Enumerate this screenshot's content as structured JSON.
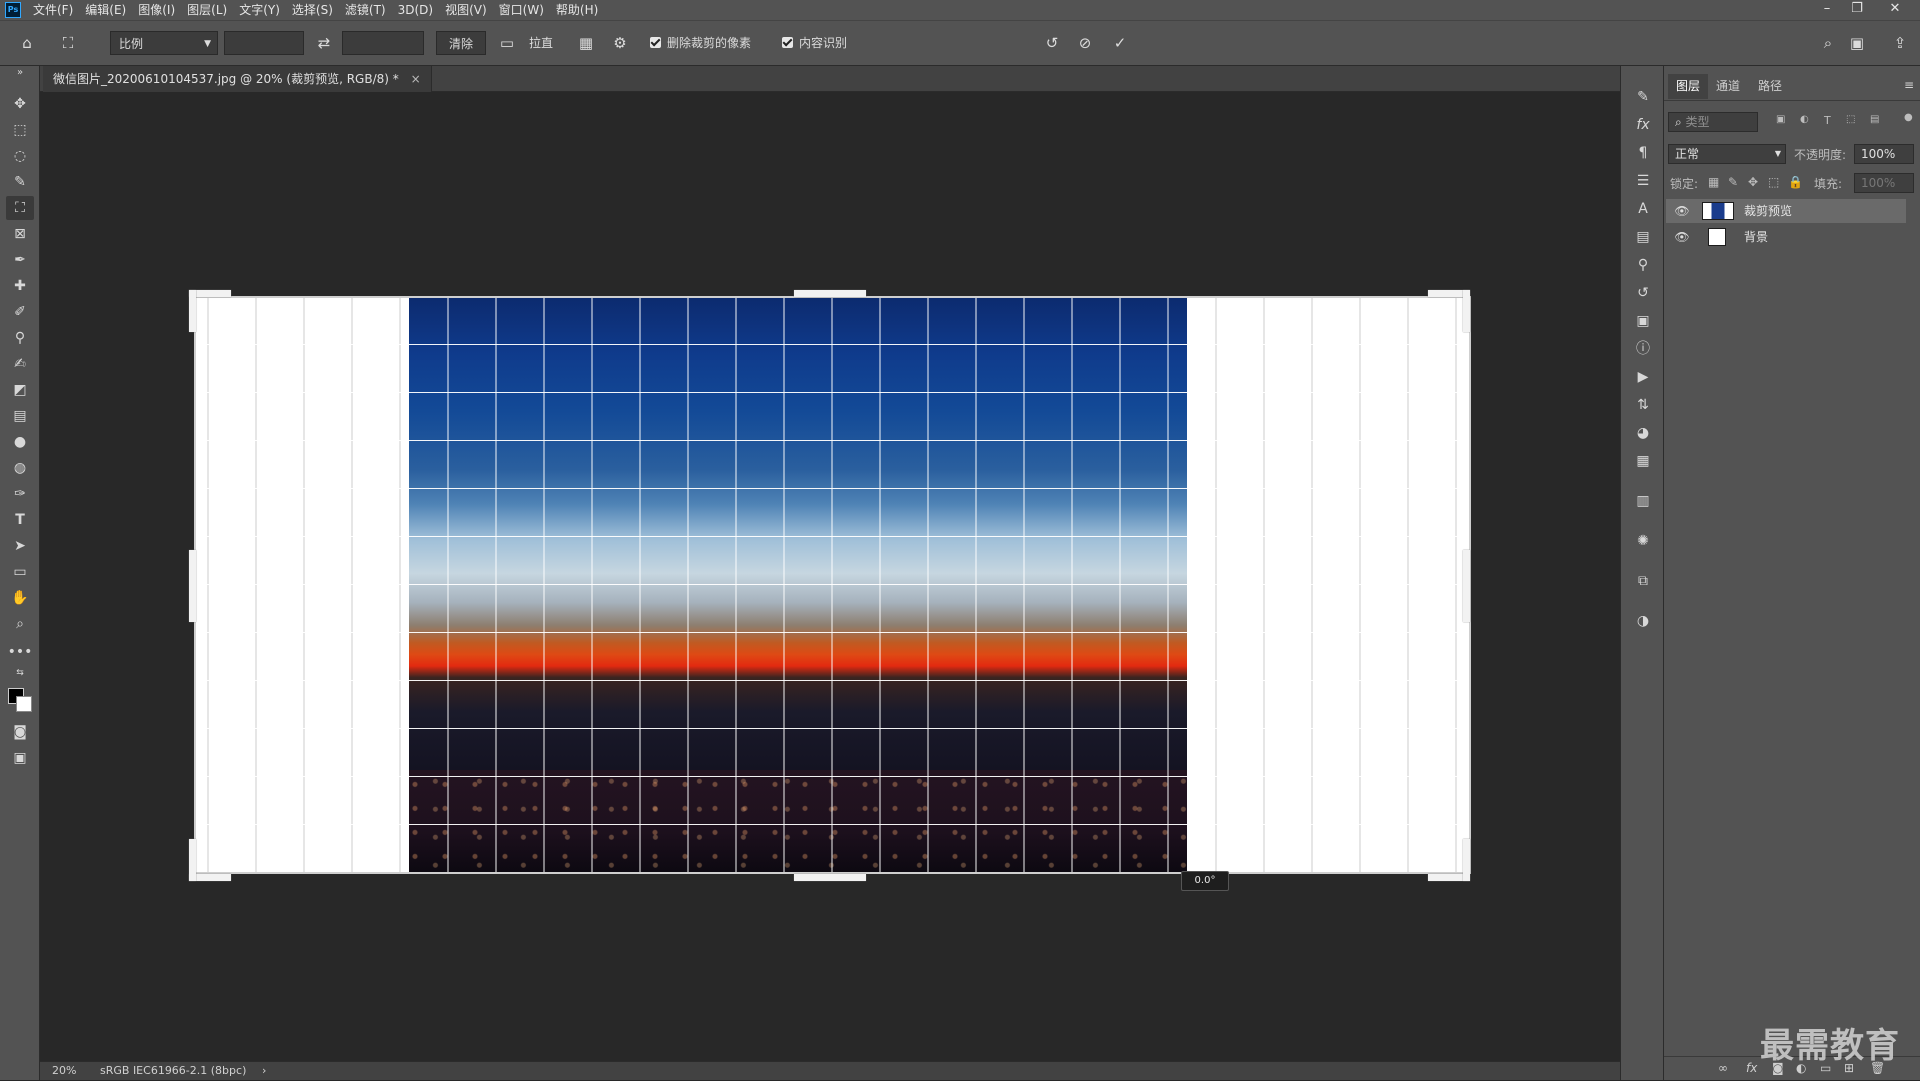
{
  "menu": [
    "文件(F)",
    "编辑(E)",
    "图像(I)",
    "图层(L)",
    "文字(Y)",
    "选择(S)",
    "滤镜(T)",
    "3D(D)",
    "视图(V)",
    "窗口(W)",
    "帮助(H)"
  ],
  "logo": "Ps",
  "window_controls": {
    "minimize": "–",
    "restore": "❐",
    "close": "✕"
  },
  "options": {
    "ratio_select": "比例",
    "width_value": "",
    "height_value": "",
    "clear_label": "清除",
    "straighten_label": "拉直",
    "delete_cropped_label": "删除裁剪的像素",
    "content_aware_label": "内容识别",
    "delete_cropped_checked": true,
    "content_aware_checked": true
  },
  "document_tab": {
    "title": "微信图片_20200610104537.jpg @ 20% (裁剪预览, RGB/8) *",
    "close": "×"
  },
  "crop": {
    "angle_readout": "0.0°"
  },
  "status": {
    "zoom": "20%",
    "profile": "sRGB IEC61966-2.1 (8bpc)",
    "arrow": "›"
  },
  "panel": {
    "tabs": [
      "图层",
      "通道",
      "路径"
    ],
    "active_tab": 0,
    "filter_placeholder": "类型",
    "blend_mode": "正常",
    "opacity_label": "不透明度:",
    "opacity_value": "100%",
    "lock_label": "锁定:",
    "fill_label": "填充:",
    "fill_value": "100%",
    "layers": [
      {
        "name": "裁剪预览",
        "visible": true,
        "selected": true
      },
      {
        "name": "背景",
        "visible": true,
        "selected": false
      }
    ]
  },
  "watermark": "最需教育",
  "colors": {
    "ui_bg": "#535353",
    "canvas_bg": "#282828",
    "accent": "#31a8ff"
  }
}
